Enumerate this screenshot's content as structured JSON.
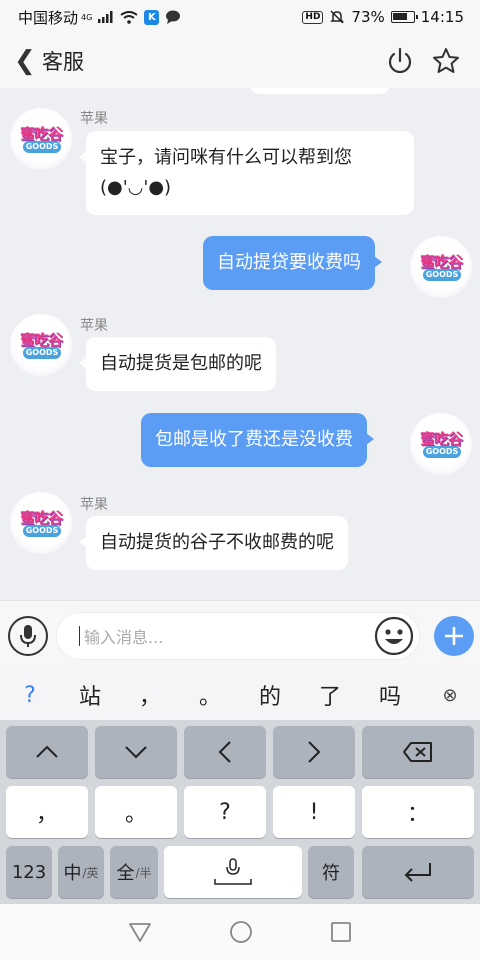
{
  "status_bar": {
    "carrier": "中国移动",
    "network": "4G",
    "app_badge": "K",
    "hd": "HD",
    "battery_text": "73%",
    "battery_level": 0.73,
    "time": "14:15"
  },
  "header": {
    "back": "❮",
    "title": "客服"
  },
  "messages": [
    {
      "sender": "苹果",
      "direction": "incoming",
      "text": "宝子，请问咪有什么可以帮到您(●'◡'●)"
    },
    {
      "direction": "outgoing",
      "text": "自动提贷要收费吗"
    },
    {
      "sender": "苹果",
      "direction": "incoming",
      "text": "自动提货是包邮的呢"
    },
    {
      "direction": "outgoing",
      "text": "包邮是收了费还是没收费"
    },
    {
      "sender": "苹果",
      "direction": "incoming",
      "text": "自动提货的谷子不收邮费的呢"
    }
  ],
  "avatar": {
    "top": "蜜吃谷",
    "bottom": "GOODS"
  },
  "input": {
    "placeholder": "输入消息..."
  },
  "suggestions": [
    "?",
    "站",
    "，",
    "。",
    "的",
    "了",
    "吗",
    "⊗"
  ],
  "keyboard": {
    "row1": [
      "︿",
      "﹀",
      "〈",
      "〉",
      "⌫"
    ],
    "row2": [
      "，",
      "。",
      "?",
      "!",
      "："
    ],
    "row3": {
      "num": "123",
      "zh_main": "中",
      "zh_sub": "/英",
      "full_main": "全",
      "full_sub": "/半",
      "symbol": "符",
      "enter": "⏎"
    }
  },
  "nav": {
    "back": "▽",
    "home": "○",
    "recent": "□"
  },
  "colors": {
    "accent": "#5b9cf5",
    "bubble_in": "#ffffff",
    "chat_bg": "#eeeff2"
  }
}
